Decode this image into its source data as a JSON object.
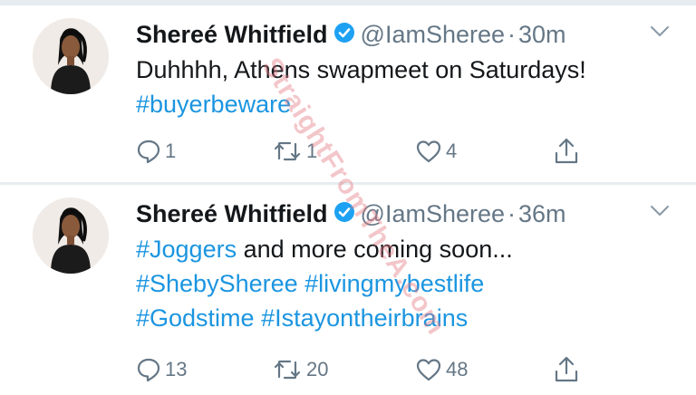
{
  "colors": {
    "text": "#14171a",
    "secondary": "#657786",
    "link": "#1b95e0",
    "verified": "#1da1f2",
    "divider": "#e6ecf0"
  },
  "tweets": [
    {
      "author_name": "Shereé Whitfield",
      "handle": "@IamSheree",
      "separator": "·",
      "time": "30m",
      "lines": [
        [
          {
            "text": "Duhhhh, Athens swapmeet on Saturdays!",
            "type": "text"
          }
        ],
        [
          {
            "text": "#buyerbeware",
            "type": "hashtag"
          }
        ]
      ],
      "reply_count": "1",
      "retweet_count": "1",
      "like_count": "4"
    },
    {
      "author_name": "Shereé Whitfield",
      "handle": "@IamSheree",
      "separator": "·",
      "time": "36m",
      "lines": [
        [
          {
            "text": "#Joggers",
            "type": "hashtag"
          },
          {
            "text": " and more coming soon...",
            "type": "text"
          }
        ],
        [
          {
            "text": "#ShebySheree",
            "type": "hashtag"
          },
          {
            "text": " ",
            "type": "text"
          },
          {
            "text": "#livingmybestlife",
            "type": "hashtag"
          }
        ],
        [
          {
            "text": "#Godstime",
            "type": "hashtag"
          },
          {
            "text": " ",
            "type": "text"
          },
          {
            "text": "#Istayontheirbrains",
            "type": "hashtag"
          }
        ]
      ],
      "reply_count": "13",
      "retweet_count": "20",
      "like_count": "48"
    }
  ],
  "icons": {
    "verified": "verified-badge-icon",
    "caret": "chevron-down-icon",
    "reply": "reply-icon",
    "retweet": "retweet-icon",
    "like": "heart-icon",
    "share": "share-icon"
  },
  "watermark": "StraightFromTheA.com"
}
